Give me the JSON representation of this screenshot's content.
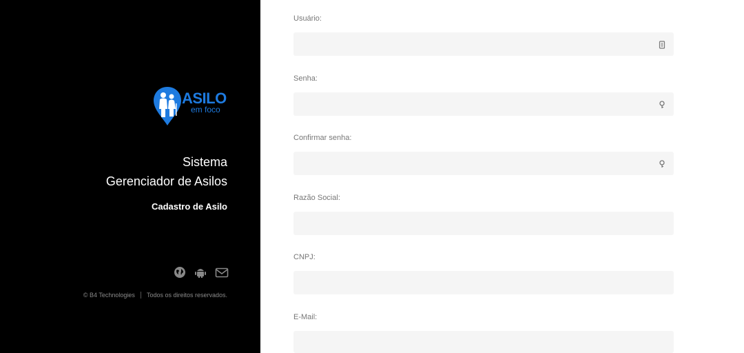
{
  "brand": {
    "logo_text": "ASILO",
    "logo_sub": "em foco",
    "logo_color": "#1e7be0"
  },
  "left_panel": {
    "title_line1": "Sistema",
    "title_line2": "Gerenciador de Asilos",
    "subtitle": "Cadastro de Asilo",
    "social_icons": [
      "globe-icon",
      "android-icon",
      "mail-icon"
    ],
    "footer_company": "© B4 Technologies",
    "footer_rights": "Todos os direitos reservados."
  },
  "form": {
    "fields": [
      {
        "label": "Usuário:",
        "value": "",
        "icon": "id-card-icon"
      },
      {
        "label": "Senha:",
        "value": "",
        "icon": "key-icon"
      },
      {
        "label": "Confirmar senha:",
        "value": "",
        "icon": "key-icon"
      },
      {
        "label": "Razão Social:",
        "value": ""
      },
      {
        "label": "CNPJ:",
        "value": ""
      },
      {
        "label": "E-Mail:",
        "value": ""
      }
    ]
  },
  "colors": {
    "left_bg": "#000000",
    "input_bg": "#f5f5f5",
    "label_color": "#777777"
  }
}
